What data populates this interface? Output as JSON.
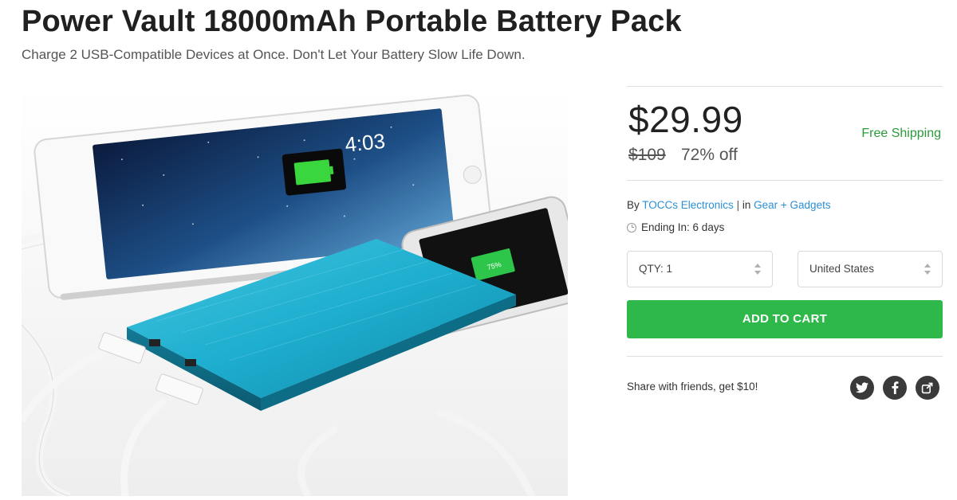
{
  "product": {
    "title": "Power Vault 18000mAh Portable Battery Pack",
    "subtitle": "Charge 2 USB-Compatible Devices at Once. Don't Let Your Battery Slow Life Down.",
    "image_screen_text": {
      "time": "4:03",
      "phone_battery": "75%"
    }
  },
  "pricing": {
    "price": "$29.99",
    "original_price": "$109",
    "discount": "72% off",
    "shipping": "Free Shipping"
  },
  "meta": {
    "by_prefix": "By",
    "vendor": "TOCCs Electronics",
    "separator": "|",
    "in_prefix": "in",
    "category": "Gear + Gadgets",
    "ending": "Ending In: 6 days"
  },
  "options": {
    "quantity": "QTY: 1",
    "country": "United States"
  },
  "cart": {
    "button_label": "ADD TO CART"
  },
  "share": {
    "text": "Share with friends, get $10!",
    "icons": [
      "twitter-icon",
      "facebook-icon",
      "share-icon"
    ]
  },
  "colors": {
    "accent_green": "#2eb84a",
    "shipping_green": "#2b9b3a",
    "link_blue": "#2b8fd5",
    "social_dark": "#3a3a3a"
  }
}
